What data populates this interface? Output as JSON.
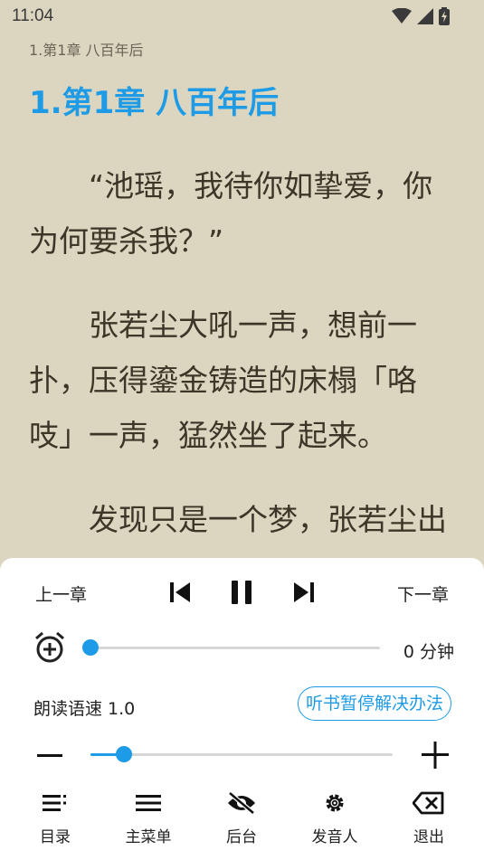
{
  "status_bar": {
    "time": "11:04"
  },
  "reader": {
    "running_head": "1.第1章 八百年后",
    "chapter_title": "1.第1章 八百年后",
    "paragraphs": [
      "“池瑶，我待你如挚爱，你为何要杀我？”",
      "张若尘大吼一声，想前一扑，压得鎏金铸造的床榻「咯吱」一声，猛然坐了起来。",
      "发现只是一个梦，张若尘出了一身一身汗水，一下子就被惊醒了。"
    ]
  },
  "tts_panel": {
    "prev_chapter_label": "上一章",
    "next_chapter_label": "下一章",
    "timer": {
      "value_label": "0 分钟",
      "progress": 0.0
    },
    "speed": {
      "label": "朗读语速 1.0",
      "help_button_label": "听书暂停解决办法",
      "progress": 0.11
    },
    "bottom_nav": [
      {
        "label": "目录",
        "icon": "toc-icon"
      },
      {
        "label": "主菜单",
        "icon": "menu-icon"
      },
      {
        "label": "后台",
        "icon": "eye-off-icon"
      },
      {
        "label": "发音人",
        "icon": "gear-icon"
      },
      {
        "label": "退出",
        "icon": "backspace-icon"
      }
    ]
  },
  "colors": {
    "accent": "#1e9be6",
    "reader_bg": "#dcd6c0",
    "text": "#3c3528"
  }
}
